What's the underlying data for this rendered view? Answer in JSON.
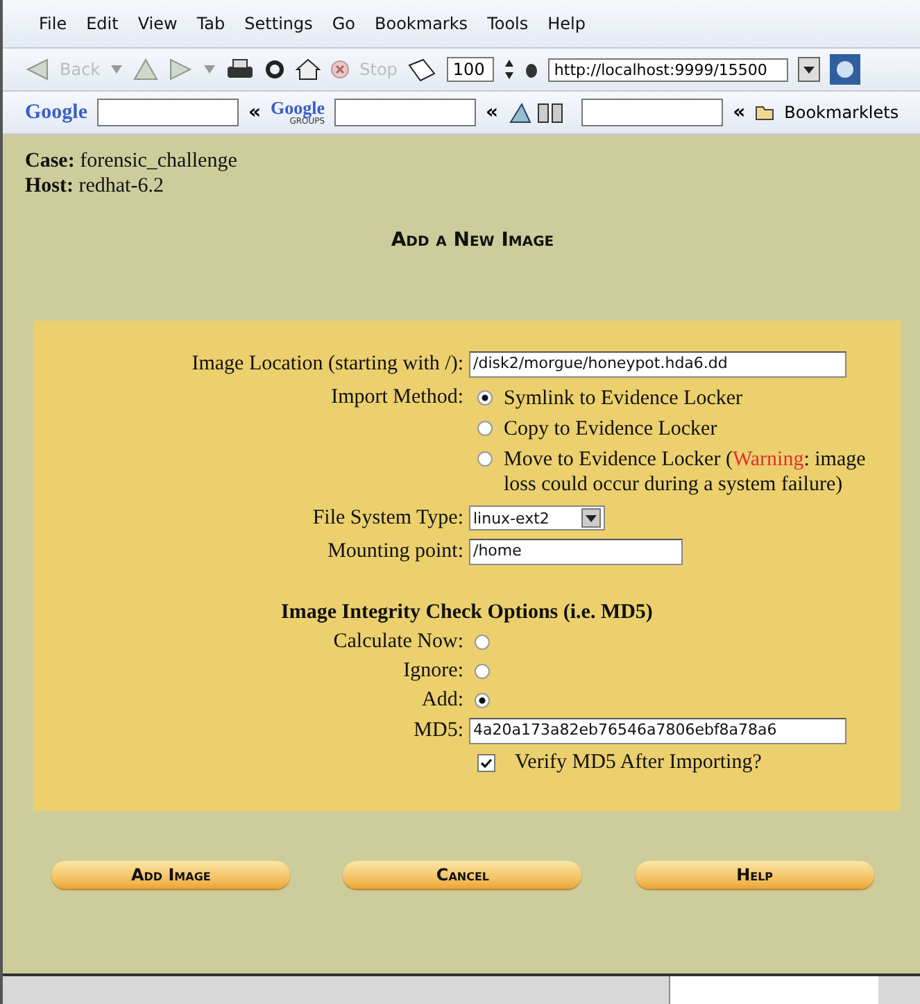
{
  "menu": [
    "File",
    "Edit",
    "View",
    "Tab",
    "Settings",
    "Go",
    "Bookmarks",
    "Tools",
    "Help"
  ],
  "nav_toolbar": {
    "back": "Back",
    "stop": "Stop",
    "zoom": "100",
    "url": "http://localhost:9999/15500"
  },
  "search_toolbar": {
    "google_logo": "Google",
    "groups_logo": "Google",
    "groups_sub": "GROUPS",
    "chevron": "«",
    "bookmarks": "Bookmarklets"
  },
  "case": {
    "label": "Case:",
    "value": "forensic_challenge"
  },
  "host": {
    "label": "Host:",
    "value": "redhat-6.2"
  },
  "heading": "Add a New Image",
  "form": {
    "location_label": "Image Location (starting with /):",
    "location_value": "/disk2/morgue/honeypot.hda6.dd",
    "import_label": "Import Method:",
    "import_methods": [
      {
        "label": "Symlink to Evidence Locker",
        "selected": true
      },
      {
        "label": "Copy to Evidence Locker",
        "selected": false
      },
      {
        "label": "Move to Evidence Locker (",
        "warning": "Warning",
        "after": ": image loss could occur during a system failure)",
        "selected": false
      }
    ],
    "fs_label": "File System Type:",
    "fs_value": "linux-ext2",
    "mount_label": "Mounting point:",
    "mount_value": "/home",
    "integrity_heading": "Image Integrity Check Options (i.e. MD5)",
    "integrity_options": [
      {
        "label": "Calculate Now:",
        "selected": false
      },
      {
        "label": "Ignore:",
        "selected": false
      },
      {
        "label": "Add:",
        "selected": true
      }
    ],
    "md5_label": "MD5:",
    "md5_value": "4a20a173a82eb76546a7806ebf8a78a6",
    "verify": {
      "label": "Verify MD5 After Importing?",
      "checked": true
    }
  },
  "buttons": [
    "Add Image",
    "Cancel",
    "Help"
  ]
}
